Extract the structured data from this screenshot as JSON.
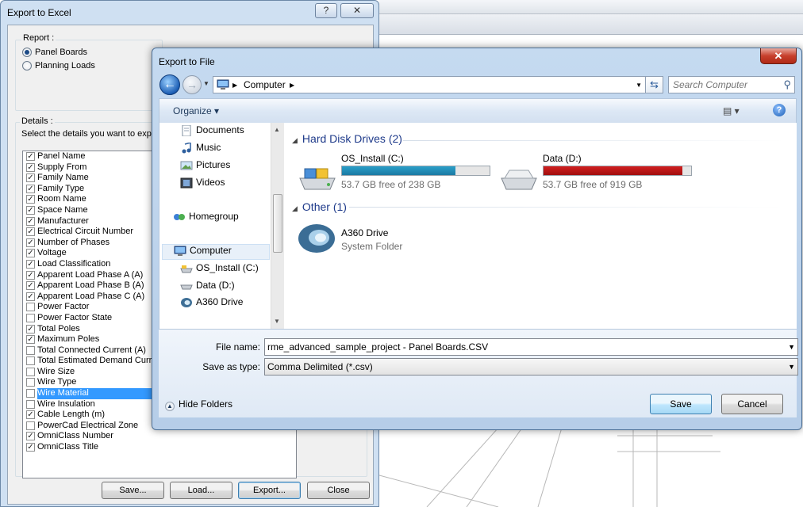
{
  "excel_dialog": {
    "title": "Export to Excel",
    "help_glyph": "?",
    "close_glyph": "✕",
    "report_label": "Report :",
    "report_options": [
      {
        "label": "Panel Boards",
        "selected": true
      },
      {
        "label": "Planning Loads",
        "selected": false
      }
    ],
    "details_label": "Details :",
    "details_hint": "Select the details you want to export",
    "details": [
      {
        "label": "Panel Name",
        "checked": true
      },
      {
        "label": "Supply From",
        "checked": true
      },
      {
        "label": "Family Name",
        "checked": true
      },
      {
        "label": "Family Type",
        "checked": true
      },
      {
        "label": "Room Name",
        "checked": true
      },
      {
        "label": "Space Name",
        "checked": true
      },
      {
        "label": "Manufacturer",
        "checked": true
      },
      {
        "label": "Electrical Circuit Number",
        "checked": true
      },
      {
        "label": "Number of Phases",
        "checked": true
      },
      {
        "label": "Voltage",
        "checked": true
      },
      {
        "label": "Load Classification",
        "checked": true
      },
      {
        "label": "Apparent Load Phase A (A)",
        "checked": true
      },
      {
        "label": "Apparent Load Phase B (A)",
        "checked": true
      },
      {
        "label": "Apparent Load Phase C (A)",
        "checked": true
      },
      {
        "label": "Power Factor",
        "checked": false
      },
      {
        "label": "Power Factor State",
        "checked": false
      },
      {
        "label": "Total Poles",
        "checked": true
      },
      {
        "label": "Maximum Poles",
        "checked": true
      },
      {
        "label": "Total Connected Current (A)",
        "checked": false
      },
      {
        "label": "Total Estimated Demand Curren",
        "checked": false
      },
      {
        "label": "Wire Size",
        "checked": false
      },
      {
        "label": "Wire Type",
        "checked": false
      },
      {
        "label": "Wire Material",
        "checked": false,
        "selected": true
      },
      {
        "label": "Wire Insulation",
        "checked": false
      },
      {
        "label": "Cable Length (m)",
        "checked": true
      },
      {
        "label": "PowerCad Electrical Zone",
        "checked": false
      },
      {
        "label": "OmniClass Number",
        "checked": true
      },
      {
        "label": "OmniClass Title",
        "checked": true
      }
    ],
    "buttons": {
      "save": "Save...",
      "load": "Load...",
      "export": "Export...",
      "close": "Close"
    }
  },
  "file_dialog": {
    "title": "Export to File",
    "close_glyph": "✕",
    "address": {
      "location": "Computer"
    },
    "search": {
      "placeholder": "Search Computer"
    },
    "organize_label": "Organize ▾",
    "nav": {
      "favorites": [
        "Documents",
        "Music",
        "Pictures",
        "Videos"
      ],
      "homegroup": "Homegroup",
      "computer": "Computer",
      "drives": [
        "OS_Install (C:)",
        "Data (D:)",
        "A360 Drive"
      ]
    },
    "sections": {
      "hard_disks": "Hard Disk Drives (2)",
      "other": "Other (1)"
    },
    "drives": [
      {
        "name": "OS_Install (C:)",
        "free": "53.7 GB free of 238 GB",
        "used_fraction": 0.77,
        "bar_color": "#2a9fc9"
      },
      {
        "name": "Data (D:)",
        "free": "53.7 GB free of 919 GB",
        "used_fraction": 0.94,
        "bar_color": "#d21f1f"
      }
    ],
    "other_item": {
      "name": "A360 Drive",
      "sub": "System Folder"
    },
    "file_name_label": "File name:",
    "file_name_value": "rme_advanced_sample_project - Panel Boards.CSV",
    "save_type_label": "Save as type:",
    "save_type_value": "Comma Delimited (*.csv)",
    "hide_folders": "Hide Folders",
    "buttons": {
      "save": "Save",
      "cancel": "Cancel"
    }
  }
}
